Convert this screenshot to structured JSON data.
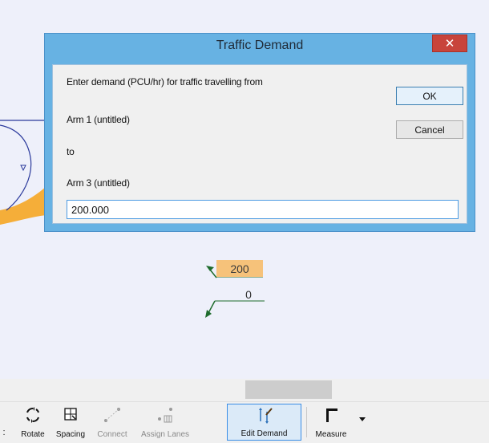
{
  "dialog": {
    "title": "Traffic Demand",
    "prompt": "Enter demand (PCU/hr) for traffic travelling from",
    "from_arm": "Arm 1 (untitled)",
    "to_label": "to",
    "to_arm": "Arm 3 (untitled)",
    "value": "200.000",
    "ok_label": "OK",
    "cancel_label": "Cancel",
    "close_glyph": "✕"
  },
  "canvas": {
    "demand_value": "200",
    "opposite_value": "0"
  },
  "toolbar": {
    "items": [
      {
        "label": "Rotate",
        "icon": "rotate-icon"
      },
      {
        "label": "Spacing",
        "icon": "spacing-icon"
      },
      {
        "label": "Connect",
        "icon": "connect-icon",
        "disabled": true
      },
      {
        "label": "Assign Lanes",
        "icon": "assign-lanes-icon",
        "disabled": true
      },
      {
        "label": "Edit Demand",
        "icon": "edit-demand-icon",
        "active": true
      },
      {
        "label": "Measure",
        "icon": "measure-icon"
      }
    ],
    "left_glyph": ":"
  },
  "colors": {
    "titlebar": "#67b2e3",
    "close_button": "#c8443b",
    "demand_highlight": "#f6c27a",
    "road_orange": "#f5a623",
    "arrow_green": "#1e6b2c"
  }
}
